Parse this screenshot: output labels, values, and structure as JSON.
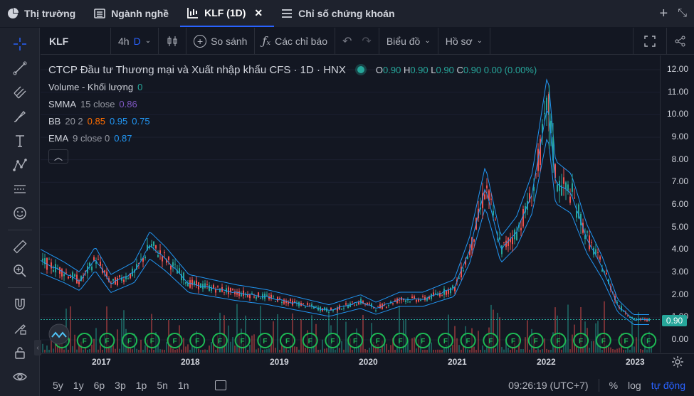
{
  "tabs": [
    {
      "label": "Thị trường",
      "icon": "pie-chart-icon"
    },
    {
      "label": "Ngành nghề",
      "icon": "list-icon"
    },
    {
      "label": "KLF (1D)",
      "icon": "candlestick-icon"
    },
    {
      "label": "Chỉ số chứng khoán",
      "icon": "menu-icon"
    }
  ],
  "toolbar": {
    "symbol": "KLF",
    "interval_1": "4h",
    "interval_2": "D",
    "compare": "So sánh",
    "indicators": "Các chỉ báo",
    "chart_type": "Biểu đồ",
    "profile": "Hồ sơ"
  },
  "legend": {
    "title": "CTCP Đầu tư Thương mại và Xuất nhập khẩu CFS · 1D · HNX",
    "ohlc": {
      "o_label": "O",
      "o": "0.90",
      "h_label": "H",
      "h": "0.90",
      "l_label": "L",
      "l": "0.90",
      "c_label": "C",
      "c": "0.90",
      "change": "0.00 (0.00%)"
    },
    "volume": {
      "name": "Volume - Khối lượng",
      "value": "0"
    },
    "smma": {
      "name": "SMMA",
      "params": "15 close",
      "value": "0.86"
    },
    "bb": {
      "name": "BB",
      "params": "20 2",
      "v1": "0.85",
      "v2": "0.95",
      "v3": "0.75"
    },
    "ema": {
      "name": "EMA",
      "params": "9 close 0",
      "value": "0.87"
    }
  },
  "price_scale": [
    "12.00",
    "11.00",
    "10.00",
    "9.00",
    "8.00",
    "7.00",
    "6.00",
    "5.00",
    "4.00",
    "3.00",
    "2.00",
    "1.00",
    "0.00"
  ],
  "last_price": "0.90",
  "time_scale": [
    "2017",
    "2018",
    "2019",
    "2020",
    "2021",
    "2022",
    "2023"
  ],
  "bottom": {
    "ranges": [
      "5y",
      "1y",
      "6p",
      "3p",
      "1p",
      "5n",
      "1n"
    ],
    "time": "09:26:19 (UTC+7)",
    "percent": "%",
    "log": "log",
    "auto": "tự động"
  },
  "colors": {
    "up": "#26a69a",
    "down": "#ef5350",
    "bb": "#2196f3",
    "bg": "#131722",
    "accent": "#2962ff"
  },
  "chart_data": {
    "type": "line",
    "x": [
      "2016-08",
      "2016-11",
      "2017-01",
      "2017-03",
      "2017-05",
      "2017-08",
      "2017-10",
      "2017-12",
      "2018-03",
      "2018-06",
      "2018-09",
      "2019-01",
      "2019-05",
      "2019-09",
      "2020-01",
      "2020-03",
      "2020-06",
      "2020-09",
      "2021-01",
      "2021-03",
      "2021-05",
      "2021-07",
      "2021-09",
      "2021-11",
      "2022-01",
      "2022-02",
      "2022-04",
      "2022-06",
      "2022-08",
      "2022-10",
      "2022-12",
      "2023-02"
    ],
    "series": [
      {
        "values": [
          3.5,
          3.0,
          2.6,
          3.6,
          2.5,
          3.0,
          4.2,
          3.6,
          2.5,
          2.3,
          2.1,
          1.9,
          1.6,
          1.3,
          1.7,
          1.4,
          1.8,
          1.8,
          2.3,
          4.0,
          6.8,
          4.0,
          4.8,
          6.5,
          10.5,
          7.0,
          6.5,
          4.5,
          3.2,
          1.5,
          0.9,
          0.9
        ]
      }
    ],
    "ylim": [
      0,
      12
    ],
    "xlabel": "",
    "ylabel": ""
  }
}
